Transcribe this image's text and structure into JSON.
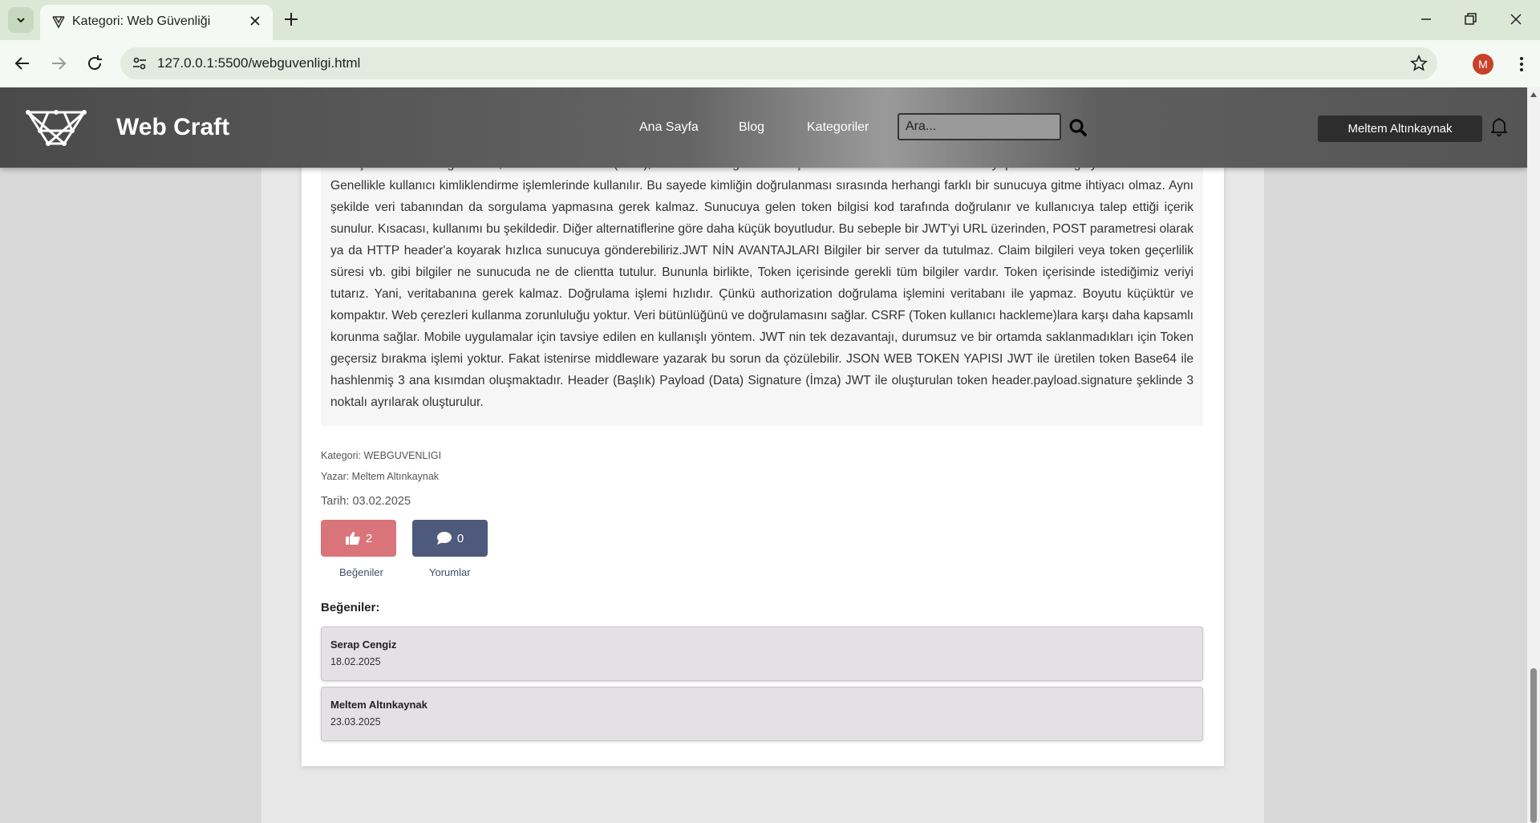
{
  "browser": {
    "tab_title": "Kategori: Web Güvenliği",
    "url": "127.0.0.1:5500/webguvenligi.html",
    "profile_initial": "M"
  },
  "header": {
    "brand": "Web Craft",
    "nav": [
      "Ana Sayfa",
      "Blog",
      "Kategoriler"
    ],
    "search_placeholder": "Ara...",
    "user_name": "Meltem Altınkaynak"
  },
  "article": {
    "body": "Basitçe ifade etmek gerekirse, JSON Web Token (JWT), taraflar arası güvenli bir şekilde JSON olarak veri aktarımı yapılmasını sağlayan bir standarttır. Genellikle kullanıcı kimliklendirme işlemlerinde kullanılır. Bu sayede kimliğin doğrulanması sırasında herhangi farklı bir sunucuya gitme ihtiyacı olmaz. Aynı şekilde veri tabanından da sorgulama yapmasına gerek kalmaz. Sunucuya gelen token bilgisi kod tarafında doğrulanır ve kullanıcıya talep ettiği içerik sunulur. Kısacası, kullanımı bu şekildedir. Diğer alternatiflerine göre daha küçük boyutludur. Bu sebeple bir JWT'yi URL üzerinden, POST parametresi olarak ya da HTTP header'a koyarak hızlıca sunucuya gönderebiliriz.JWT NİN AVANTAJLARI Bilgiler bir server da tutulmaz. Claim bilgileri veya token geçerlilik süresi vb. gibi bilgiler ne sunucuda ne de clientta tutulur. Bununla birlikte, Token içerisinde gerekli tüm bilgiler vardır. Token içerisinde istediğimiz veriyi tutarız. Yani, veritabanına gerek kalmaz. Doğrulama işlemi hızlıdır. Çünkü authorization doğrulama işlemini veritabanı ile yapmaz. Boyutu küçüktür ve kompaktır. Web çerezleri kullanma zorunluluğu yoktur. Veri bütünlüğünü ve doğrulamasını sağlar. CSRF (Token kullanıcı hackleme)lara karşı daha kapsamlı korunma sağlar. Mobile uygulamalar için tavsiye edilen en kullanışlı yöntem. JWT nin tek dezavantajı, durumsuz ve bir ortamda saklanmadıkları için Token geçersiz bırakma işlemi yoktur. Fakat istenirse middleware yazarak bu sorun da çözülebilir. JSON WEB TOKEN YAPISI JWT ile üretilen token Base64 ile hashlenmiş 3 ana kısımdan oluşmaktadır. Header (Başlık) Payload (Data) Signature (İmza) JWT ile oluşturulan token header.payload.signature şeklinde 3 noktalı ayrılarak oluşturulur.",
    "category": "Kategori: WEBGUVENLIGI",
    "author": "Yazar: Meltem Altınkaynak",
    "date": "Tarih: 03.02.2025",
    "like_count": "2",
    "comment_count": "0",
    "like_caption": "Beğeniler",
    "comment_caption": "Yorumlar"
  },
  "likes": {
    "heading": "Beğeniler:",
    "entries": [
      {
        "name": "Serap Cengiz",
        "date": "18.02.2025"
      },
      {
        "name": "Meltem Altınkaynak",
        "date": "23.03.2025"
      }
    ]
  },
  "colors": {
    "like_button": "#d9757a",
    "comment_button": "#4d5a7c",
    "user_button": "#2d2d2d",
    "avatar": "#c8412a"
  }
}
